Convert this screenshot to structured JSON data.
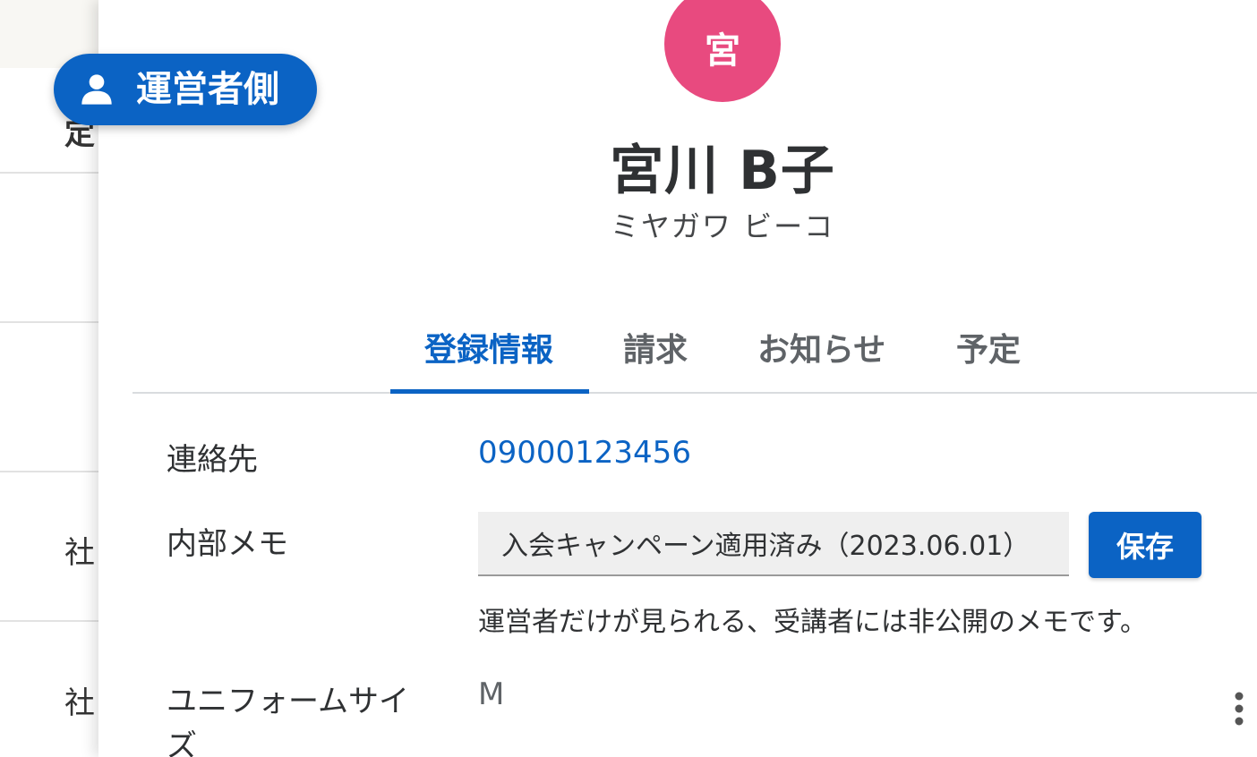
{
  "background_list": {
    "partial_header": "定",
    "rows": [
      "社",
      "社"
    ]
  },
  "role_badge": {
    "icon": "person-icon",
    "label": "運営者側"
  },
  "profile": {
    "avatar_initial": "宮",
    "avatar_color": "#e84a7f",
    "name": "宮川 B子",
    "kana": "ミヤガワ ビーコ"
  },
  "tabs": [
    {
      "label": "登録情報",
      "active": true
    },
    {
      "label": "請求",
      "active": false
    },
    {
      "label": "お知らせ",
      "active": false
    },
    {
      "label": "予定",
      "active": false
    }
  ],
  "fields": {
    "contact": {
      "label": "連絡先",
      "value": "09000123456"
    },
    "memo": {
      "label": "内部メモ",
      "value": "入会キャンペーン適用済み（2023.06.01）",
      "save_label": "保存",
      "help": "運営者だけが見られる、受講者には非公開のメモです。"
    },
    "uniform": {
      "label_line1": "ユニフォームサイ",
      "label_line2": "ズ",
      "value": "M"
    }
  },
  "colors": {
    "accent": "#0b63c4",
    "avatar": "#e84a7f"
  },
  "icons": {
    "more": "more-vert-icon"
  }
}
